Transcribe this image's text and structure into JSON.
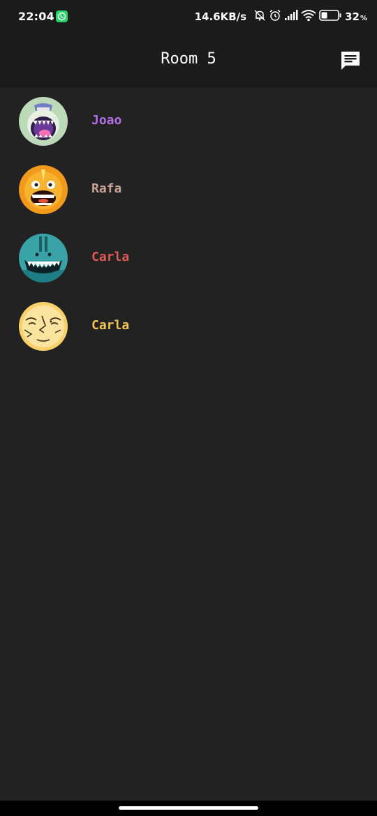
{
  "status_bar": {
    "time": "22:04",
    "network_speed": "14.6KB/s",
    "battery_percent": "32",
    "battery_sign": "%",
    "icons": [
      "whatsapp-icon",
      "mute-bell-icon",
      "alarm-icon",
      "signal-icon",
      "wifi-icon",
      "battery-icon"
    ]
  },
  "header": {
    "title": "Room 5",
    "chat_icon": "chat-icon"
  },
  "users": [
    {
      "name": "Joao",
      "color": "#b36fe8",
      "avatar": "purple-mouth-monster-avatar"
    },
    {
      "name": "Rafa",
      "color": "#c9a195",
      "avatar": "orange-unicorn-monster-avatar"
    },
    {
      "name": "Carla",
      "color": "#e25858",
      "avatar": "teal-teeth-monster-avatar"
    },
    {
      "name": "Carla",
      "color": "#f2c550",
      "avatar": "yellow-sketch-face-avatar"
    }
  ],
  "colors": {
    "background": "#222222",
    "bar": "#1b1b1b"
  }
}
